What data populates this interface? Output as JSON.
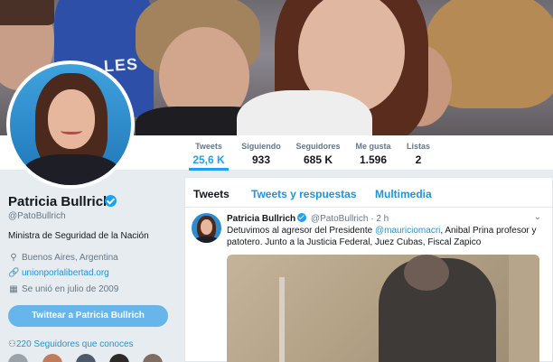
{
  "profile": {
    "name": "Patricia Bullrich",
    "handle": "@PatoBullrich",
    "bio": "Ministra de Seguridad de la Nación",
    "location": "Buenos Aires, Argentina",
    "website": "unionporlalibertad.org",
    "joined": "Se unió en julio de 2009",
    "tweet_to_button": "Twittear a Patricia Bullrich",
    "followers_you_know": "220 Seguidores que conoces"
  },
  "nav": {
    "stats": [
      {
        "label": "Tweets",
        "value": "25,6 K"
      },
      {
        "label": "Siguiendo",
        "value": "933"
      },
      {
        "label": "Seguidores",
        "value": "685 K"
      },
      {
        "label": "Me gusta",
        "value": "1.596"
      },
      {
        "label": "Listas",
        "value": "2"
      }
    ],
    "active_index": 0
  },
  "timeline": {
    "tabs": [
      {
        "label": "Tweets"
      },
      {
        "label": "Tweets y respuestas"
      },
      {
        "label": "Multimedia"
      }
    ],
    "tweet": {
      "name": "Patricia Bullrich",
      "handle": "@PatoBullrich",
      "separator": "·",
      "time": "2 h",
      "text_before": "Detuvimos al agresor del Presidente ",
      "mention": "@mauriciomacri",
      "text_after": ", Anibal Prina profesor y patotero. Junto a la Justicia Federal, Juez Cubas, Fiscal Zapico"
    }
  },
  "header_photo": {
    "sign_text": "LES"
  },
  "colors": {
    "accent": "#1da1f2",
    "link": "#1b95e0",
    "button": "#66b5eb",
    "background": "#e6ecf0"
  },
  "icons": {
    "location": "map-pin-icon",
    "link": "link-icon",
    "joined": "calendar-icon",
    "followers": "person-icon",
    "verified": "verified-badge-icon",
    "caret": "chevron-down-icon"
  }
}
